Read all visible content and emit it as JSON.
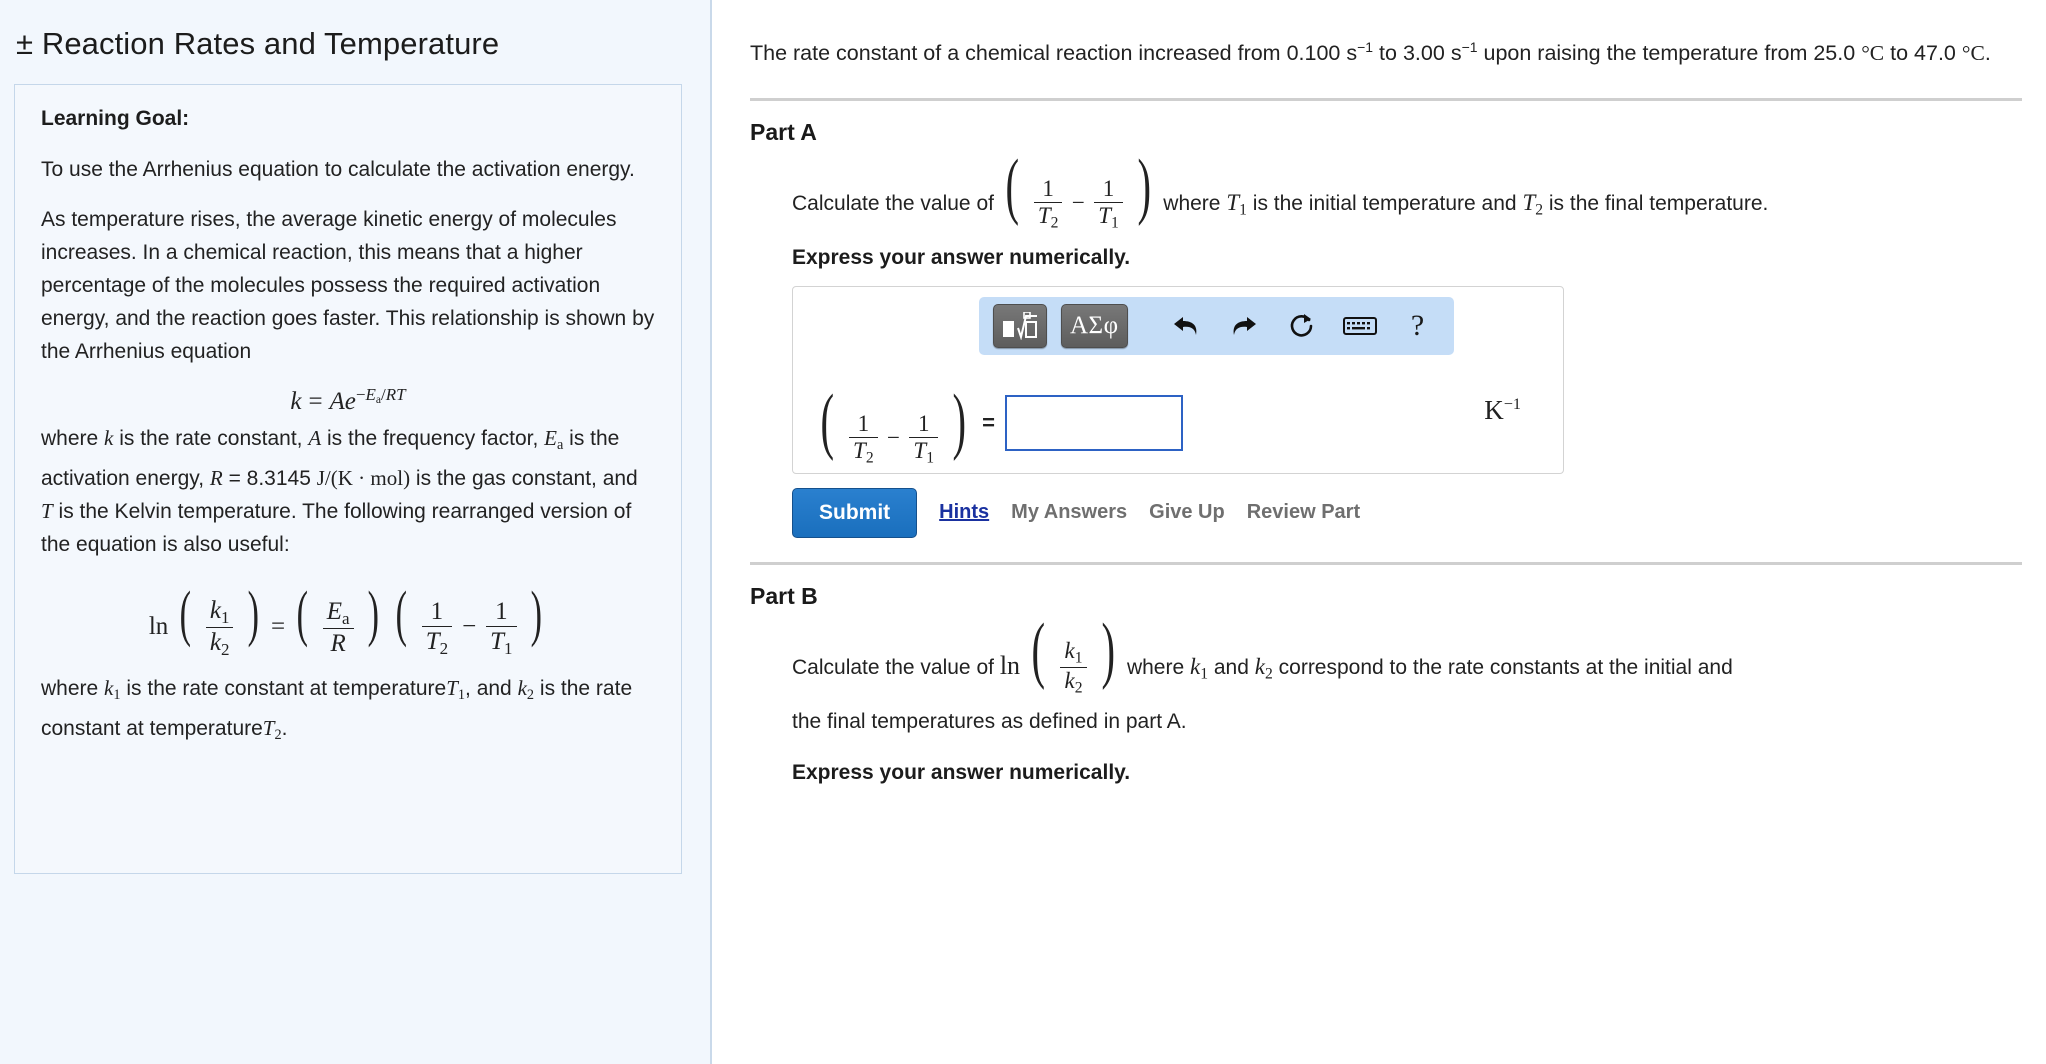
{
  "left": {
    "title": "± Reaction Rates and Temperature",
    "goal_heading": "Learning Goal:",
    "goal_p1": "To use the Arrhenius equation to calculate the activation energy.",
    "goal_p2": "As temperature rises, the average kinetic energy of molecules increases. In a chemical reaction, this means that a higher percentage of the molecules possess the required activation energy, and the reaction goes faster. This relationship is shown by the Arrhenius equation",
    "eq_arrhenius": "k = Ae^(-Ea/RT)",
    "where_1": "where",
    "where_k": "k",
    "where_2": "is the rate constant,",
    "where_A": "A",
    "where_3": "is the frequency factor,",
    "where_Ea": "Ea",
    "where_4": "is the activation energy,",
    "where_R": "R",
    "where_5": "= 8.3145",
    "where_unit": "J/(K · mol)",
    "where_6": "is the gas constant, and",
    "where_T": "T",
    "where_7": "is the Kelvin temperature. The following rearranged version of the equation is also useful:",
    "eq_rearranged": "ln(k1/k2) = (Ea/R)(1/T2 - 1/T1)",
    "foot_1": "where",
    "foot_k1": "k1",
    "foot_2": "is the rate constant at temperature",
    "foot_T1": "T1",
    "foot_3": ", and",
    "foot_k2": "k2",
    "foot_4": "is the rate constant at temperature",
    "foot_T2": "T2",
    "foot_5": "."
  },
  "stem": {
    "s1": "The rate constant of a chemical reaction increased from",
    "k_initial": "0.100",
    "unit_s": "s",
    "exp": "−1",
    "s2": "to",
    "k_final": "3.00",
    "s3": "upon raising the temperature from",
    "t_initial": "25.0",
    "deg_c": "°C",
    "s4": "to",
    "t_final": "47.0",
    "s5": "."
  },
  "partA": {
    "label": "Part A",
    "q_before": "Calculate the value of",
    "q_mid": "where",
    "q_T1": "T1",
    "q_after1": "is the initial temperature and",
    "q_T2": "T2",
    "q_after2": "is the final temperature.",
    "express": "Express your answer numerically.",
    "answer_value": "",
    "answer_unit": "K",
    "answer_unit_exp": "−1",
    "equals": "=",
    "toolbar": {
      "template_icon": "math-template-icon",
      "greek_label": "ΑΣφ",
      "undo_icon": "undo-arrow-icon",
      "redo_icon": "redo-arrow-icon",
      "reset_icon": "reset-circle-icon",
      "keyboard_icon": "keyboard-icon",
      "help_label": "?"
    },
    "submit": "Submit",
    "hints": "Hints",
    "my_answers": "My Answers",
    "give_up": "Give Up",
    "review_part": "Review Part"
  },
  "partB": {
    "label": "Part B",
    "q_before": "Calculate the value of",
    "ln": "ln",
    "q_mid": "where",
    "q_k1": "k1",
    "q_and": "and",
    "q_k2": "k2",
    "q_after": "correspond to the rate constants at the initial and",
    "q_line2": "the final temperatures as defined in part A.",
    "express": "Express your answer numerically."
  },
  "colors": {
    "panel_bg": "#f2f7fd",
    "accent_blue": "#1a6fbd",
    "link_blue": "#1a31a0",
    "toolbar_bg": "#c5ddf7",
    "input_border": "#2d62c4"
  }
}
